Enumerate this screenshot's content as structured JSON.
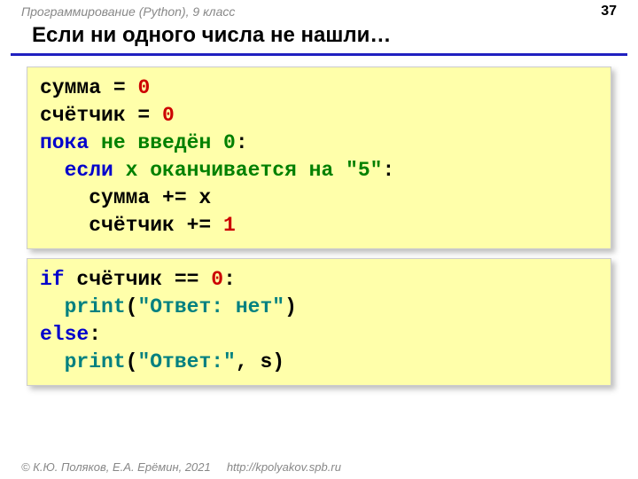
{
  "header": {
    "course": "Программирование (Python), 9 класс",
    "page": "37"
  },
  "title": "Если ни одного числа не нашли…",
  "code1": {
    "l1a": "сумма",
    "l1b": " = ",
    "l1c": "0",
    "l2a": "счётчик",
    "l2b": " = ",
    "l2c": "0",
    "l3a": "пока",
    "l3b": " не введён 0",
    "l3c": ":",
    "l4a": "  если",
    "l4b": " x оканчивается на \"5\"",
    "l4c": ":",
    "l5": "    сумма += x",
    "l6a": "    счётчик += ",
    "l6b": "1"
  },
  "code2": {
    "l1a": "if",
    "l1b": " счётчик == ",
    "l1c": "0",
    "l1d": ":",
    "l2a": "  print",
    "l2b": "(",
    "l2c": "\"Ответ: нет\"",
    "l2d": ")",
    "l3a": "else",
    "l3b": ":",
    "l4a": "  print",
    "l4b": "(",
    "l4c": "\"Ответ:\"",
    "l4d": ", s)"
  },
  "footer": {
    "copyright": "© К.Ю. Поляков, Е.А. Ерёмин, 2021",
    "url": "http://kpolyakov.spb.ru"
  }
}
